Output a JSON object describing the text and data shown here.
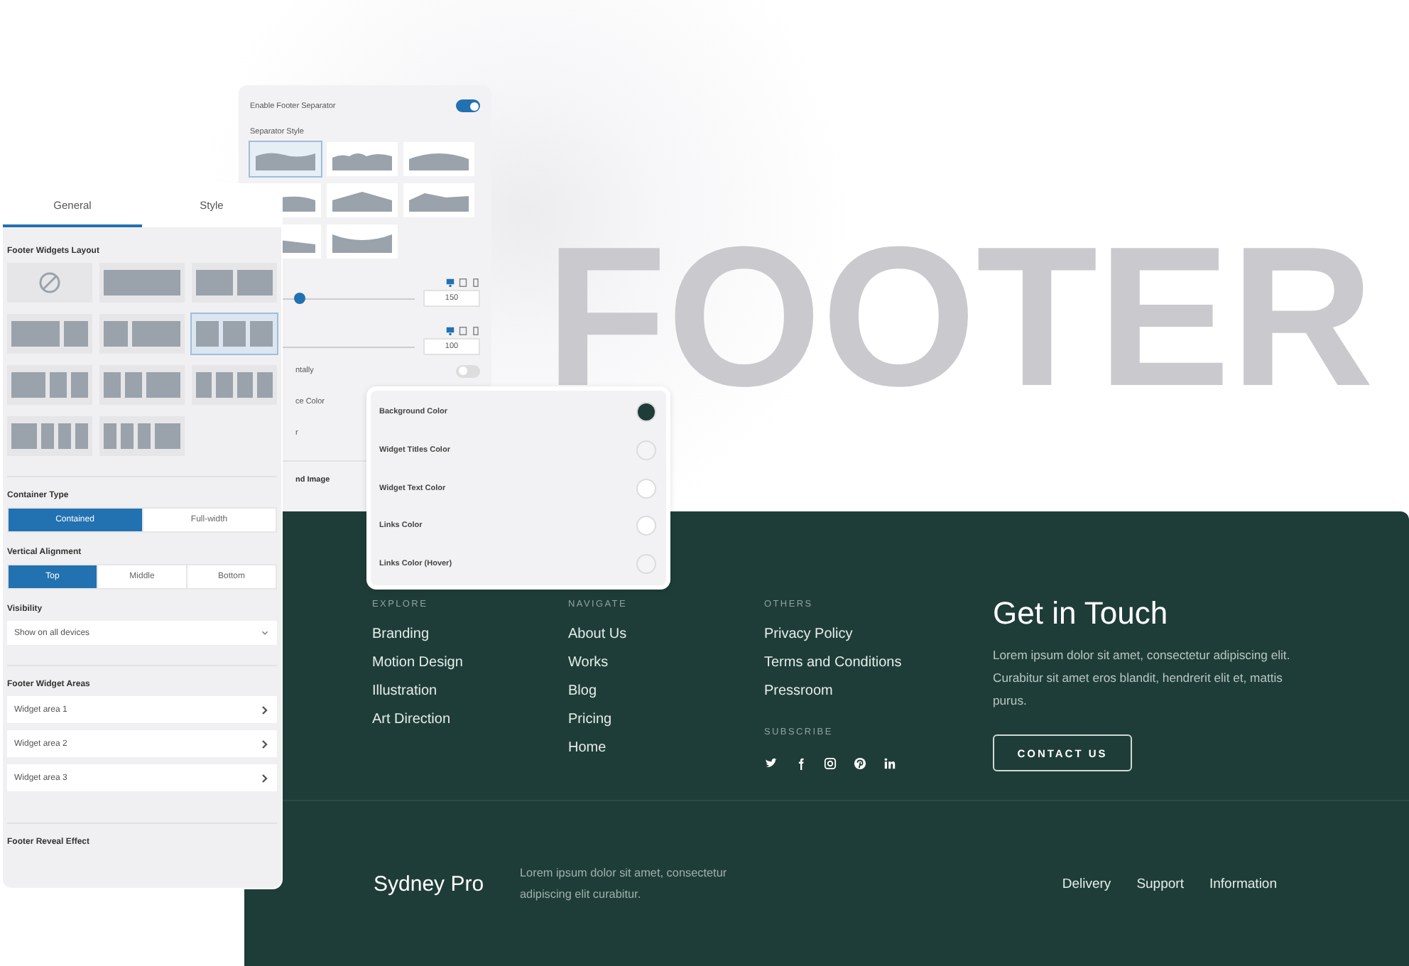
{
  "background_text": "FOOTER",
  "separator_panel": {
    "toggle": {
      "label": "Enable Footer Separator",
      "on": true
    },
    "style_label": "Separator Style",
    "styles": [
      {
        "kind": "wave",
        "selected": true
      },
      {
        "kind": "clouds",
        "selected": false
      },
      {
        "kind": "dome",
        "selected": false
      },
      {
        "kind": "hill",
        "selected": false
      },
      {
        "kind": "peak",
        "selected": false
      },
      {
        "kind": "ridge",
        "selected": false
      },
      {
        "kind": "slope",
        "selected": false
      },
      {
        "kind": "valley",
        "selected": false
      }
    ],
    "sliders": [
      {
        "value": "150",
        "level": 0.3
      },
      {
        "value": "100"
      }
    ],
    "rows": [
      {
        "kind": "toggle",
        "label": "ntally",
        "on": false
      },
      {
        "kind": "text",
        "label": "ce Color"
      },
      {
        "kind": "text",
        "label": "r"
      },
      {
        "kind": "heading",
        "label": "nd Image"
      }
    ]
  },
  "left_panel": {
    "tabs": [
      {
        "label": "General",
        "selected": true
      },
      {
        "label": "Style",
        "selected": false
      }
    ],
    "layout_label": "Footer Widgets Layout",
    "layouts": [
      {
        "kind": "none",
        "selected": false
      },
      {
        "kind": "one",
        "selected": false
      },
      {
        "kind": "two",
        "selected": false
      },
      {
        "kind": "two-left",
        "selected": false
      },
      {
        "kind": "two-right",
        "selected": false
      },
      {
        "kind": "three",
        "selected": true
      },
      {
        "kind": "three-left",
        "selected": false
      },
      {
        "kind": "three-right",
        "selected": false
      },
      {
        "kind": "four",
        "selected": false
      },
      {
        "kind": "four-left",
        "selected": false
      },
      {
        "kind": "four-right",
        "selected": false
      }
    ],
    "container": {
      "label": "Container Type",
      "options": [
        {
          "label": "Contained",
          "selected": true
        },
        {
          "label": "Full-width",
          "selected": false
        }
      ]
    },
    "alignment": {
      "label": "Vertical Alignment",
      "options": [
        {
          "label": "Top",
          "selected": true
        },
        {
          "label": "Middle",
          "selected": false
        },
        {
          "label": "Bottom",
          "selected": false
        }
      ]
    },
    "visibility": {
      "label": "Visibility",
      "value": "Show on all devices"
    },
    "areas": {
      "label": "Footer Widget Areas",
      "items": [
        "Widget area 1",
        "Widget area 2",
        "Widget area 3"
      ]
    },
    "reveal_label": "Footer Reveal Effect"
  },
  "color_panel": {
    "items": [
      {
        "label": "Background Color",
        "color": "#1f3d38"
      },
      {
        "label": "Widget Titles Color",
        "color": "#f4f4f6"
      },
      {
        "label": "Widget Text Color",
        "color": "#ffffff"
      },
      {
        "label": "Links Color",
        "color": "#ffffff"
      },
      {
        "label": "Links Color (Hover)",
        "color": "#f4f4f6"
      }
    ]
  },
  "footer": {
    "columns": [
      {
        "heading": "EXPLORE",
        "links": [
          "Branding",
          "Motion Design",
          "Illustration",
          "Art Direction"
        ]
      },
      {
        "heading": "NAVIGATE",
        "links": [
          "About Us",
          "Works",
          "Blog",
          "Pricing",
          "Home"
        ]
      },
      {
        "heading": "OTHERS",
        "links": [
          "Privacy Policy",
          "Terms and Conditions",
          "Pressroom"
        ],
        "subscribe": "SUBSCRIBE"
      }
    ],
    "contact": {
      "title": "Get in Touch",
      "text": "Lorem ipsum dolor sit amet, consectetur adipiscing elit. Curabitur sit amet eros blandit, hendrerit elit et, mattis purus.",
      "button": "CONTACT US"
    },
    "brand": "Sydney Pro",
    "bottom_text": "Lorem ipsum dolor sit amet, consectetur adipiscing elit curabitur.",
    "bottom_links": [
      "Delivery",
      "Support",
      "Information"
    ]
  }
}
